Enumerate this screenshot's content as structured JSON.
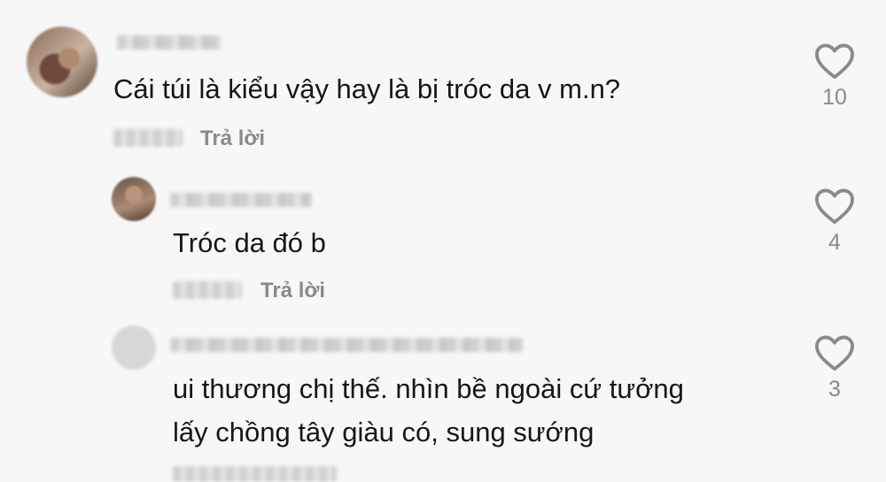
{
  "comments": [
    {
      "text": "Cái túi là kiểu vậy hay là bị tróc da v m.n?",
      "reply_label": "Trả lời",
      "likes": "10"
    },
    {
      "text": "Tróc da đó b",
      "reply_label": "Trả lời",
      "likes": "4"
    },
    {
      "text_line1": "ui thương chị thế. nhìn bề ngoài cứ tưởng",
      "text_line2": "lấy chồng tây giàu có, sung sướng",
      "likes": "3"
    }
  ],
  "icons": {
    "like": "heart-outline-icon"
  },
  "colors": {
    "background": "#f7f7f7",
    "text": "#161616",
    "secondary": "#8a8a8a"
  }
}
